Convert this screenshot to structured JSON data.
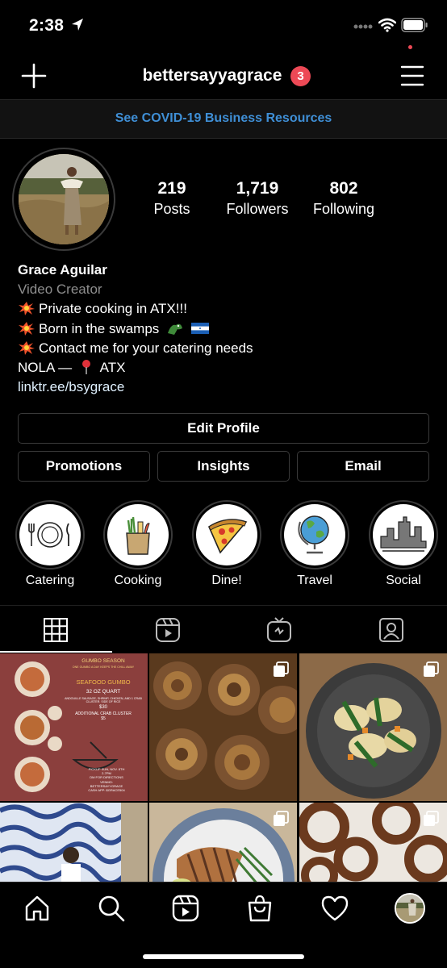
{
  "status_bar": {
    "time": "2:38"
  },
  "header": {
    "username": "bettersayyagrace",
    "notification_count": "3"
  },
  "banner": {
    "text": "See COVID-19 Business Resources"
  },
  "stats": [
    {
      "value": "219",
      "label": "Posts"
    },
    {
      "value": "1,719",
      "label": "Followers"
    },
    {
      "value": "802",
      "label": "Following"
    }
  ],
  "bio": {
    "name": "Grace Aguilar",
    "category": "Video Creator",
    "lines": [
      "Private cooking in ATX!!!",
      "Born in the swamps",
      "Contact me for your catering needs"
    ],
    "location_prefix": "NOLA —",
    "location_suffix": "ATX",
    "link": "linktr.ee/bsygrace"
  },
  "buttons": {
    "edit_profile": "Edit Profile",
    "promotions": "Promotions",
    "insights": "Insights",
    "email": "Email"
  },
  "highlights": [
    {
      "label": "Catering",
      "icon": "plate-cutlery-icon"
    },
    {
      "label": "Cooking",
      "icon": "grocery-bag-icon"
    },
    {
      "label": "Dine!",
      "icon": "pizza-slice-icon"
    },
    {
      "label": "Travel",
      "icon": "globe-icon"
    },
    {
      "label": "Social",
      "icon": "city-skyline-icon"
    }
  ],
  "profile_tabs": [
    "grid-icon",
    "reels-icon",
    "igtv-icon",
    "tagged-icon"
  ],
  "post_flyer": {
    "heading": "GUMBO SEASON",
    "subheading": "ONE GUMBO A DAY KEEPS THE CHILL AWAY",
    "dish": "SEAFOOD GUMBO",
    "size": "32 OZ QUART",
    "ingredients": "ANDOUILLE SAUSAGE, SHRIMP, CHICKEN, AND 1 CRAB CLUSTER. SIDE OF RICE",
    "price": "$30",
    "extra": "ADDITIONAL CRAB CLUSTER",
    "extra_price": "$5",
    "pickup": "PICKUP SUN, NOV. 8TH",
    "hours": "2-7PM",
    "dm": "DM FOR DIRECTIONS",
    "venmo": "VENMO:",
    "venmo_handle": "BETTERSAYYGRACE",
    "cashapp": "CASH APP: $GRACE504"
  },
  "bottom_nav": [
    "home-icon",
    "search-icon",
    "reels-icon",
    "shop-icon",
    "activity-heart-icon",
    "profile-avatar"
  ],
  "colors": {
    "accent_link": "#3f8fd6",
    "badge": "#ed4956",
    "background": "#000000"
  }
}
